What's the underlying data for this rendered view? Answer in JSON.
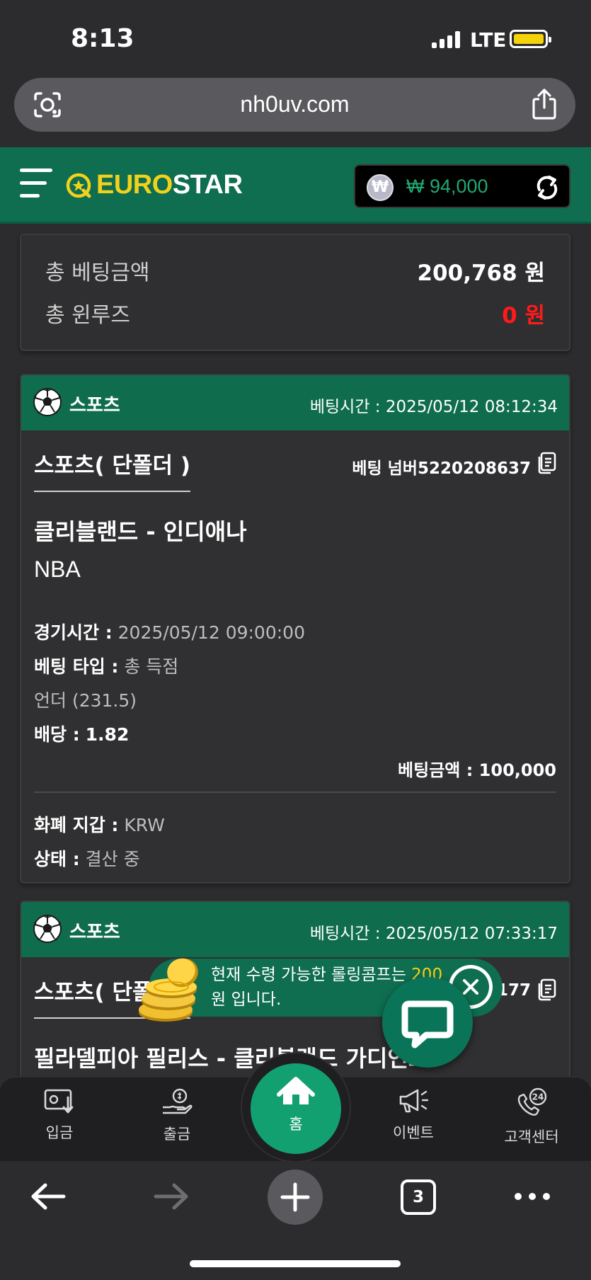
{
  "status_bar": {
    "time": "8:13",
    "network": "LTE"
  },
  "browser": {
    "url": "nh0uv.com",
    "open_tabs": "3"
  },
  "header": {
    "logo_part1": "EURO",
    "logo_part2": "STAR",
    "currency_symbol": "₩",
    "balance": "₩ 94,000"
  },
  "summary": {
    "total_bet_label": "총 베팅금액",
    "total_bet_value": "200,768 원",
    "total_winloss_label": "총 윈루즈",
    "total_winloss_value": "0 원"
  },
  "bets": [
    {
      "category": "스포츠",
      "bet_time": "베팅시간 : 2025/05/12 08:12:34",
      "bet_type_title": "스포츠( 단폴더 )",
      "bet_number": "베팅 넘버5220208637",
      "match": "클리블랜드 - 인디애나",
      "league": "NBA",
      "game_time_label": "경기시간 :",
      "game_time": "2025/05/12 09:00:00",
      "bet_kind_label": "베팅 타입 :",
      "bet_kind": "총 득점",
      "selection": "언더 (231.5)",
      "odds_label": "배당 :",
      "odds": "1.82",
      "amount": "베팅금액 : 100,000",
      "wallet_label": "화폐 지갑 :",
      "wallet": "KRW",
      "status_label": "상태 :",
      "status": "결산 중"
    },
    {
      "category": "스포츠",
      "bet_time": "베팅시간 : 2025/05/12 07:33:17",
      "bet_type_title": "스포츠( 단폴더 )",
      "bet_number_tail": "3177",
      "match": "필라델피아 필리스 - 클리블랜드 가디언즈"
    }
  ],
  "toast": {
    "text_before": "현재 수령 가능한 롤링콤프는 ",
    "amount": "200",
    "text_after": " 원 입니다."
  },
  "bottom_nav": {
    "deposit": "입금",
    "withdraw": "출금",
    "home": "홈",
    "event": "이벤트",
    "support": "고객센터",
    "support_badge": "24"
  },
  "colors": {
    "brand_green": "#0e6e4f",
    "logo_yellow": "#f3d11b",
    "balance_green": "#1fa972",
    "loss_red": "#ff1a1a",
    "home_button": "#13a070"
  }
}
